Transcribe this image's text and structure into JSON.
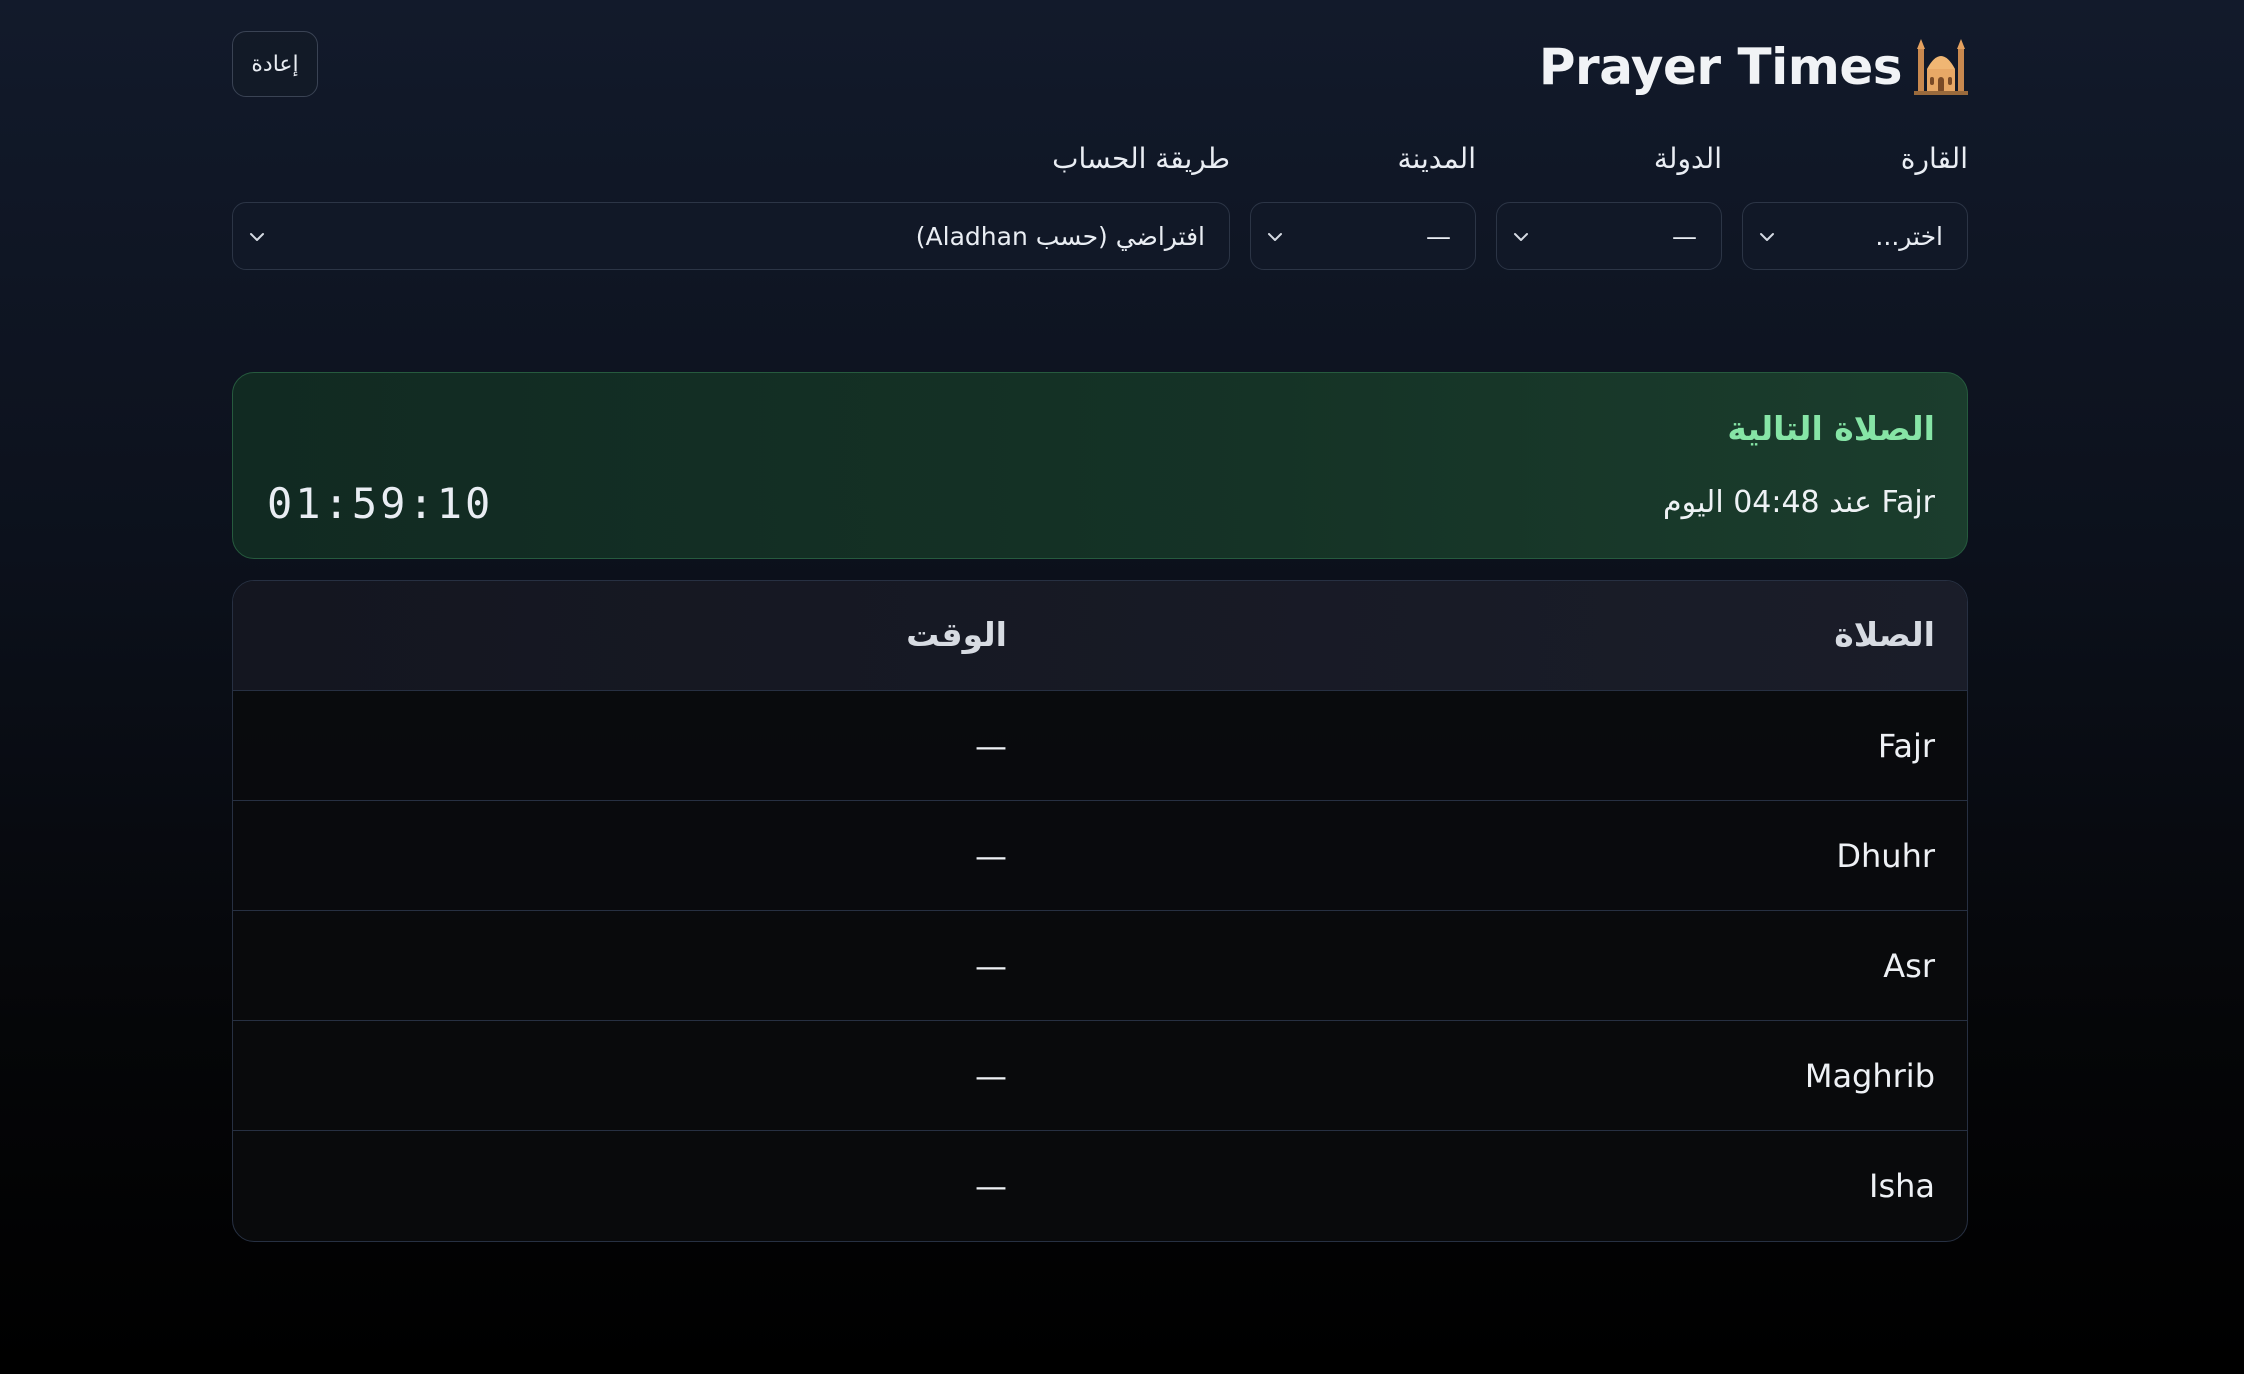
{
  "header": {
    "title": "Prayer Times",
    "icon": "mosque-icon",
    "reset_label": "إعادة"
  },
  "filters": {
    "continent": {
      "label": "القارة",
      "value": "اختر..."
    },
    "country": {
      "label": "الدولة",
      "value": "—"
    },
    "city": {
      "label": "المدينة",
      "value": "—"
    },
    "method": {
      "label": "طريقة الحساب",
      "value": "افتراضي (حسب Aladhan)"
    }
  },
  "next_prayer": {
    "title": "الصلاة التالية",
    "detail": "Fajr عند 04:48 اليوم",
    "countdown": "01:59:10"
  },
  "table": {
    "headers": {
      "prayer": "الصلاة",
      "time": "الوقت"
    },
    "rows": [
      {
        "prayer": "Fajr",
        "time": "—"
      },
      {
        "prayer": "Dhuhr",
        "time": "—"
      },
      {
        "prayer": "Asr",
        "time": "—"
      },
      {
        "prayer": "Maghrib",
        "time": "—"
      },
      {
        "prayer": "Isha",
        "time": "—"
      }
    ]
  },
  "colors": {
    "accent_green": "#86e5a6",
    "card_border": "#265a3e",
    "background_top": "#121a2b"
  }
}
